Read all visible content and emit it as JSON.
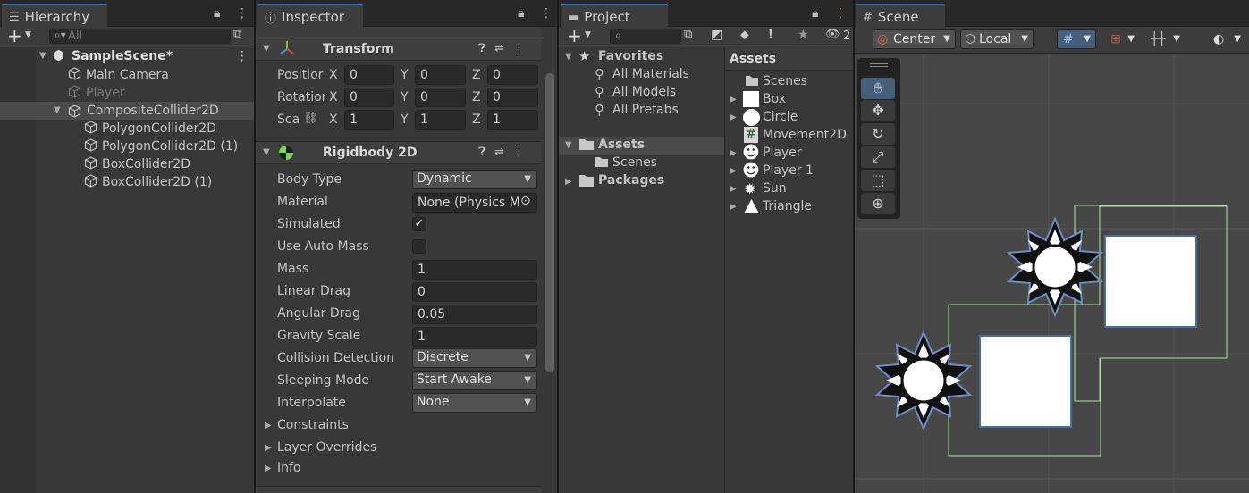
{
  "hierarchy": {
    "tab": "Hierarchy",
    "search_placeholder": "All",
    "scene": "SampleScene*",
    "items": [
      "Main Camera",
      "Player",
      "CompositeCollider2D",
      "PolygonCollider2D",
      "PolygonCollider2D (1)",
      "BoxCollider2D",
      "BoxCollider2D (1)"
    ]
  },
  "inspector": {
    "tab": "Inspector",
    "transform": {
      "title": "Transform",
      "position_label": "Positior",
      "rotation_label": "Rotatior",
      "scale_label": "Sca",
      "x": "X",
      "y": "Y",
      "z": "Z",
      "position": [
        "0",
        "0",
        "0"
      ],
      "rotation": [
        "0",
        "0",
        "0"
      ],
      "scale": [
        "1",
        "1",
        "1"
      ]
    },
    "rigidbody": {
      "title": "Rigidbody 2D",
      "body_type_label": "Body Type",
      "body_type": "Dynamic",
      "material_label": "Material",
      "material": "None (Physics M",
      "simulated_label": "Simulated",
      "simulated_mark": "✓",
      "auto_mass_label": "Use Auto Mass",
      "mass_label": "Mass",
      "mass": "1",
      "linear_drag_label": "Linear Drag",
      "linear_drag": "0",
      "angular_drag_label": "Angular Drag",
      "angular_drag": "0.05",
      "gravity_label": "Gravity Scale",
      "gravity": "1",
      "collision_label": "Collision Detection",
      "collision": "Discrete",
      "sleeping_label": "Sleeping Mode",
      "sleeping": "Start Awake",
      "interpolate_label": "Interpolate",
      "interpolate": "None",
      "constraints": "Constraints",
      "layer_overrides": "Layer Overrides",
      "info": "Info"
    }
  },
  "project": {
    "tab": "Project",
    "hidden_count": "2",
    "favorites": "Favorites",
    "fav_items": [
      "All Materials",
      "All Models",
      "All Prefabs"
    ],
    "assets": "Assets",
    "assets_scenes": "Scenes",
    "packages": "Packages",
    "list_header": "Assets",
    "list": [
      "Scenes",
      "Box",
      "Circle",
      "Movement2D",
      "Player",
      "Player 1",
      "Sun",
      "Triangle"
    ]
  },
  "scene": {
    "tab": "Scene",
    "pivot": "Center",
    "space": "Local"
  },
  "colors": {
    "accent": "#3a79bb",
    "selected": "#2c5d87",
    "panel": "#383838"
  }
}
